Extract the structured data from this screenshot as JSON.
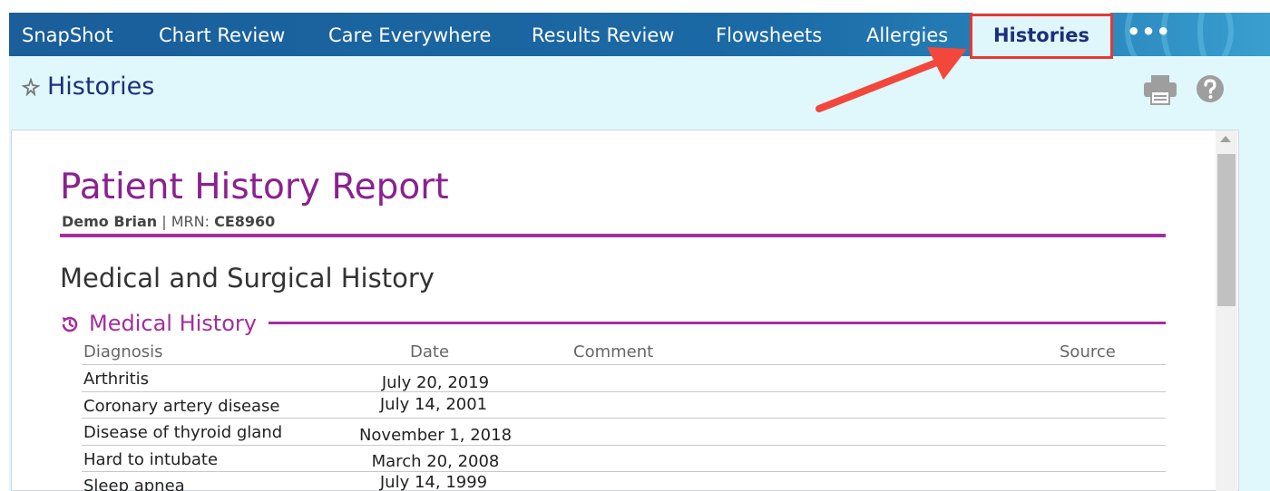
{
  "nav": {
    "tabs": [
      {
        "label": "SnapShot"
      },
      {
        "label": "Chart Review"
      },
      {
        "label": "Care Everywhere"
      },
      {
        "label": "Results Review"
      },
      {
        "label": "Flowsheets"
      },
      {
        "label": "Allergies"
      },
      {
        "label": "Histories",
        "active": true
      }
    ],
    "more_label": "•••"
  },
  "header": {
    "title": "Histories",
    "icons": [
      "pin-icon",
      "print-icon",
      "help-icon"
    ]
  },
  "report": {
    "title": "Patient History Report",
    "patient_name": "Demo Brian",
    "mrn_label": "| MRN:",
    "mrn_value": "CE8960",
    "section_title": "Medical and Surgical History",
    "subsection_title": "Medical History",
    "columns": {
      "diagnosis": "Diagnosis",
      "date": "Date",
      "comment": "Comment",
      "source": "Source"
    },
    "rows": [
      {
        "diagnosis": "Arthritis",
        "date": "July 20, 2019"
      },
      {
        "diagnosis": "Coronary artery disease",
        "date": "July 14, 2001"
      },
      {
        "diagnosis": "Disease of thyroid gland",
        "date": "November 1, 2018"
      },
      {
        "diagnosis": "Hard to intubate",
        "date": "March 20, 2008"
      },
      {
        "diagnosis": "Sleep apnea",
        "date": "July 14, 1999"
      }
    ]
  },
  "colors": {
    "nav_bg": "#1b6aa5",
    "active_tab_bg": "#dff6fb",
    "accent_purple": "#a22e9e",
    "title_purple": "#8a2190",
    "highlight_red": "#e53935"
  }
}
